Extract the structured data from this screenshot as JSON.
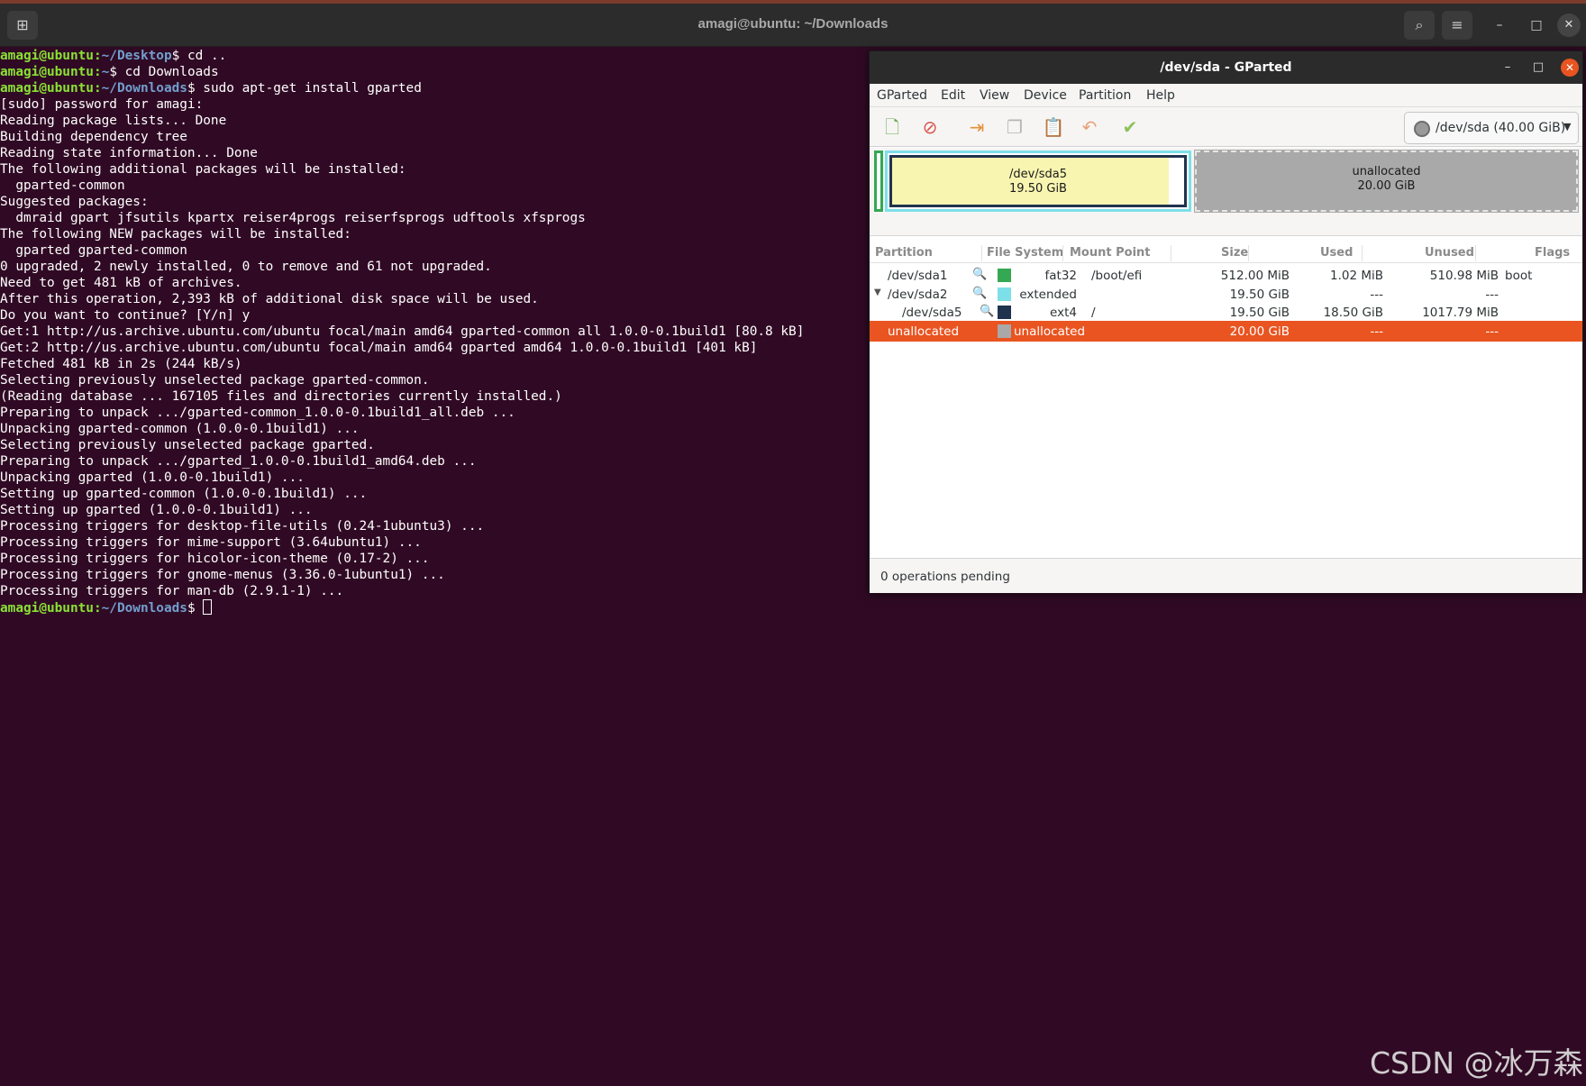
{
  "terminal": {
    "title": "amagi@ubuntu: ~/Downloads",
    "lines": [
      {
        "user": "amagi@ubuntu",
        "path": "~/Desktop",
        "text": " cd .."
      },
      {
        "user": "amagi@ubuntu",
        "path": "~",
        "text": " cd Downloads"
      },
      {
        "user": "amagi@ubuntu",
        "path": "~/Downloads",
        "text": " sudo apt-get install gparted"
      },
      {
        "text": "[sudo] password for amagi:"
      },
      {
        "text": "Reading package lists... Done"
      },
      {
        "text": "Building dependency tree"
      },
      {
        "text": "Reading state information... Done"
      },
      {
        "text": "The following additional packages will be installed:"
      },
      {
        "text": "  gparted-common"
      },
      {
        "text": "Suggested packages:"
      },
      {
        "text": "  dmraid gpart jfsutils kpartx reiser4progs reiserfsprogs udftools xfsprogs"
      },
      {
        "text": "The following NEW packages will be installed:"
      },
      {
        "text": "  gparted gparted-common"
      },
      {
        "text": "0 upgraded, 2 newly installed, 0 to remove and 61 not upgraded."
      },
      {
        "text": "Need to get 481 kB of archives."
      },
      {
        "text": "After this operation, 2,393 kB of additional disk space will be used."
      },
      {
        "text": "Do you want to continue? [Y/n] y"
      },
      {
        "text": "Get:1 http://us.archive.ubuntu.com/ubuntu focal/main amd64 gparted-common all 1.0.0-0.1build1 [80.8 kB]"
      },
      {
        "text": "Get:2 http://us.archive.ubuntu.com/ubuntu focal/main amd64 gparted amd64 1.0.0-0.1build1 [401 kB]"
      },
      {
        "text": "Fetched 481 kB in 2s (244 kB/s)"
      },
      {
        "text": "Selecting previously unselected package gparted-common."
      },
      {
        "text": "(Reading database ... 167105 files and directories currently installed.)"
      },
      {
        "text": "Preparing to unpack .../gparted-common_1.0.0-0.1build1_all.deb ..."
      },
      {
        "text": "Unpacking gparted-common (1.0.0-0.1build1) ..."
      },
      {
        "text": "Selecting previously unselected package gparted."
      },
      {
        "text": "Preparing to unpack .../gparted_1.0.0-0.1build1_amd64.deb ..."
      },
      {
        "text": "Unpacking gparted (1.0.0-0.1build1) ..."
      },
      {
        "text": "Setting up gparted-common (1.0.0-0.1build1) ..."
      },
      {
        "text": "Setting up gparted (1.0.0-0.1build1) ..."
      },
      {
        "text": "Processing triggers for desktop-file-utils (0.24-1ubuntu3) ..."
      },
      {
        "text": "Processing triggers for mime-support (3.64ubuntu1) ..."
      },
      {
        "text": "Processing triggers for hicolor-icon-theme (0.17-2) ..."
      },
      {
        "text": "Processing triggers for gnome-menus (3.36.0-1ubuntu1) ..."
      },
      {
        "text": "Processing triggers for man-db (2.9.1-1) ..."
      },
      {
        "user": "amagi@ubuntu",
        "path": "~/Downloads",
        "text": " ",
        "cursor": true
      }
    ]
  },
  "gparted": {
    "title": "/dev/sda - GParted",
    "menu": [
      "GParted",
      "Edit",
      "View",
      "Device",
      "Partition",
      "Help"
    ],
    "device": "/dev/sda (40.00 GiB)",
    "graphic": {
      "sda5_name": "/dev/sda5",
      "sda5_size": "19.50 GiB",
      "unalloc_name": "unallocated",
      "unalloc_size": "20.00 GiB"
    },
    "columns": [
      "Partition",
      "File System",
      "Mount Point",
      "Size",
      "Used",
      "Unused",
      "Flags"
    ],
    "rows": [
      {
        "partition": "/dev/sda1",
        "fs": "fat32",
        "mount": "/boot/efi",
        "size": "512.00 MiB",
        "used": "1.02 MiB",
        "unused": "510.98 MiB",
        "flags": "boot",
        "color": "#34a853"
      },
      {
        "partition": "/dev/sda2",
        "fs": "extended",
        "mount": "",
        "size": "19.50 GiB",
        "used": "---",
        "unused": "---",
        "flags": "",
        "color": "#7ddfe8"
      },
      {
        "partition": "/dev/sda5",
        "fs": "ext4",
        "mount": "/",
        "size": "19.50 GiB",
        "used": "18.50 GiB",
        "unused": "1017.79 MiB",
        "flags": "",
        "color": "#20334e"
      },
      {
        "partition": "unallocated",
        "fs": "unallocated",
        "mount": "",
        "size": "20.00 GiB",
        "used": "---",
        "unused": "---",
        "flags": "",
        "color": "#a9a9a9"
      }
    ],
    "status": "0 operations pending"
  },
  "watermark": "CSDN @冰万森"
}
